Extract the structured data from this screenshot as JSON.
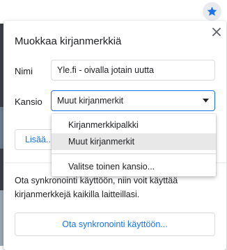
{
  "toolbar": {
    "bookmark_star_icon": "star-icon"
  },
  "dialog": {
    "title": "Muokkaa kirjanmerkkiä",
    "close_icon": "close-icon",
    "name_label": "Nimi",
    "name_value": "Yle.fi - oivalla jotain uutta",
    "folder_label": "Kansio",
    "folder_value": "Muut kirjanmerkit",
    "more_button": "Lisää...",
    "sync_text": "Ota synkronointi käyttöön, niin voit käyttää kirjanmerkkejä kaikilla laitteillasi.",
    "sync_button": "Ota synkronointi käyttöön..."
  },
  "dropdown": {
    "options": [
      "Kirjanmerkkipalkki",
      "Muut kirjanmerkit"
    ],
    "selected": "Muut kirjanmerkit",
    "other_folder": "Valitse toinen kansio..."
  },
  "colors": {
    "accent": "#1a73e8",
    "star": "#1a73e8"
  }
}
